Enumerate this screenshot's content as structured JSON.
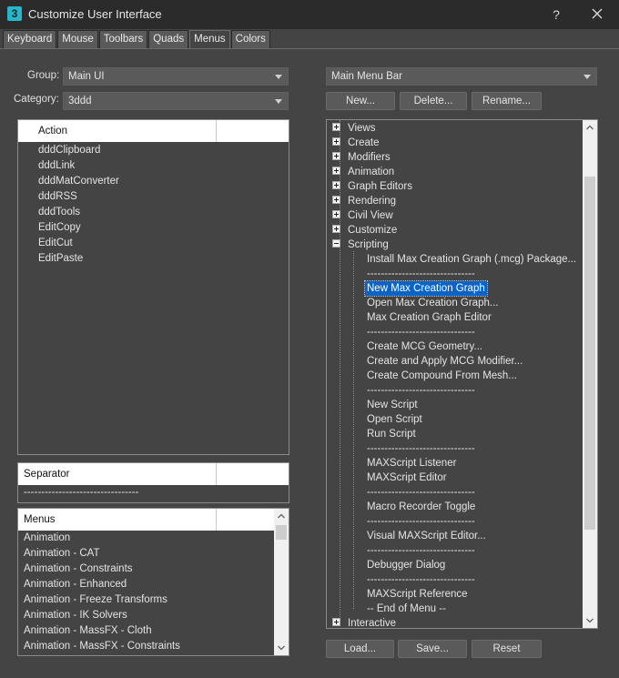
{
  "window": {
    "title": "Customize User Interface",
    "app_icon_text": "3",
    "help_label": "?"
  },
  "tabs": [
    {
      "label": "Keyboard",
      "active": false
    },
    {
      "label": "Mouse",
      "active": false
    },
    {
      "label": "Toolbars",
      "active": false
    },
    {
      "label": "Quads",
      "active": false
    },
    {
      "label": "Menus",
      "active": true
    },
    {
      "label": "Colors",
      "active": false
    }
  ],
  "left": {
    "group_label": "Group:",
    "group_value": "Main UI",
    "category_label": "Category:",
    "category_value": "3ddd",
    "actions_header": "Action",
    "actions": [
      "dddClipboard",
      "dddLink",
      "dddMatConverter",
      "dddRSS",
      "dddTools",
      "EditCopy",
      "EditCut",
      "EditPaste"
    ],
    "separator_header": "Separator",
    "separator_item": "---------------------------------",
    "menus_header": "Menus",
    "menus": [
      "Animation",
      "Animation - CAT",
      "Animation - Constraints",
      "Animation - Enhanced",
      "Animation - Freeze Transforms",
      "Animation - IK Solvers",
      "Animation - MassFX - Cloth",
      "Animation - MassFX - Constraints"
    ]
  },
  "right": {
    "menu_bar_value": "Main Menu Bar",
    "new_button": "New...",
    "delete_button": "Delete...",
    "rename_button": "Rename...",
    "tree_top": [
      "Views",
      "Create",
      "Modifiers",
      "Animation",
      "Graph Editors",
      "Rendering",
      "Civil View",
      "Customize"
    ],
    "expanded_item": "Scripting",
    "scripting_children": [
      "Install Max Creation Graph (.mcg) Package...",
      "-------------------------------",
      "New Max Creation Graph",
      "Open Max Creation Graph...",
      "Max Creation Graph Editor",
      "-------------------------------",
      "Create MCG Geometry...",
      "Create and Apply MCG Modifier...",
      "Create Compound From Mesh...",
      "-------------------------------",
      "New Script",
      "Open Script",
      "Run Script",
      "-------------------------------",
      "MAXScript Listener",
      "MAXScript Editor",
      "-------------------------------",
      "Macro Recorder Toggle",
      "-------------------------------",
      "Visual MAXScript Editor...",
      "-------------------------------",
      "Debugger Dialog",
      "-------------------------------",
      "MAXScript Reference",
      "-- End of Menu --"
    ],
    "selected_child": "New Max Creation Graph",
    "tree_bottom": [
      "Interactive"
    ]
  },
  "footer": {
    "load_button": "Load...",
    "save_button": "Save...",
    "reset_button": "Reset"
  },
  "colors": {
    "background": "#444444",
    "titlebar": "#2b2b2b",
    "selection": "#0a64c8",
    "icon_accent": "#27b5c9"
  }
}
